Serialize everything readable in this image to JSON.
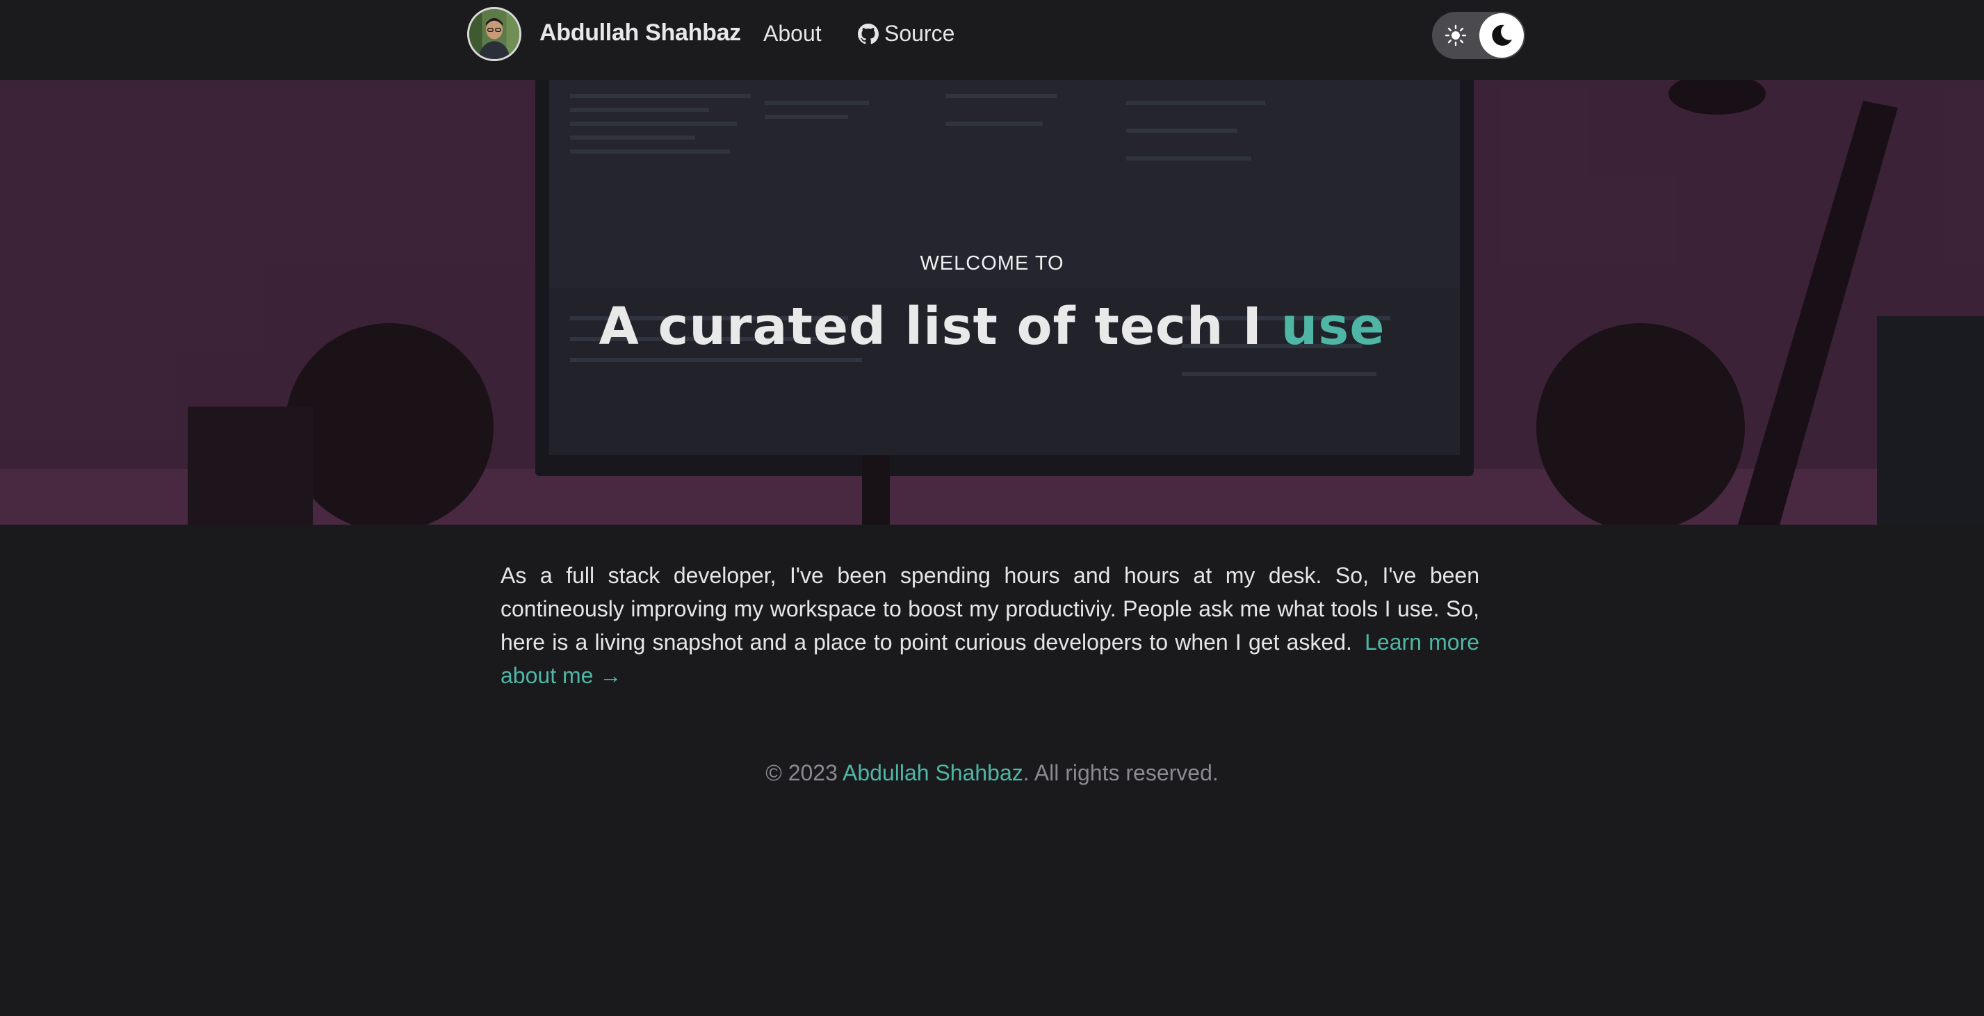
{
  "nav": {
    "brand": "Abdullah Shahbaz",
    "about_label": "About",
    "source_label": "Source"
  },
  "hero": {
    "eyebrow": "WELCOME TO",
    "title_main": "A curated list of tech I ",
    "title_accent": "use"
  },
  "intro": {
    "text": "As a full stack developer, I've been spending hours and hours at my desk. So, I've been contineously improving my workspace to boost my productiviy. People ask me what tools I use. So, here is a living snapshot and a place to point curious developers to when I get asked.",
    "link_label": "Learn more about me →"
  },
  "footer": {
    "prefix": "© 2023 ",
    "author": "Abdullah Shahbaz",
    "suffix": ". All rights reserved."
  },
  "colors": {
    "accent": "#4fb6a5",
    "background": "#1a1a1d"
  },
  "icons": {
    "avatar": "profile-photo",
    "source": "github-icon",
    "theme_light": "sun-icon",
    "theme_dark": "moon-icon"
  }
}
